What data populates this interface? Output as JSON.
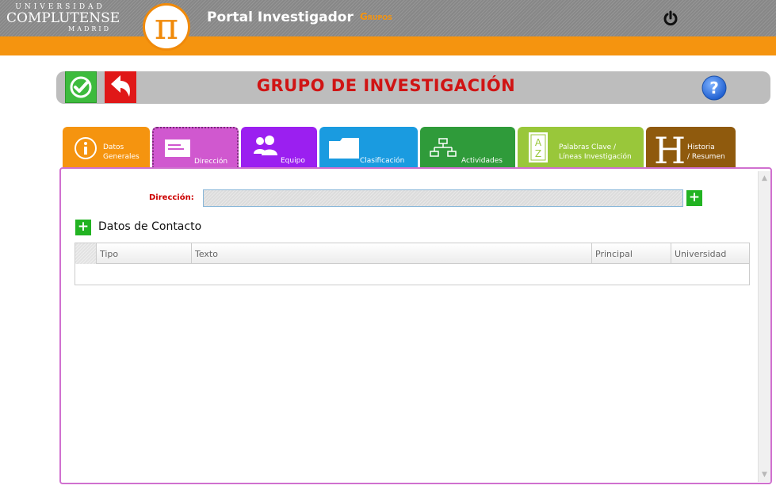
{
  "header": {
    "university_top": "UNIVERSIDAD",
    "university_mid": "COMPLUTENSE",
    "university_bot": "MADRID",
    "app_logo_symbol": "π",
    "portal_title": "Portal Investigador",
    "section_link": "Grupos",
    "power_icon": "power-icon"
  },
  "toolbar": {
    "save_icon": "check-icon",
    "back_icon": "undo-arrow-icon",
    "help_icon": "help-icon"
  },
  "page": {
    "title": "GRUPO DE INVESTIGACIÓN"
  },
  "tabs": [
    {
      "line1": "Datos",
      "line2": "Generales",
      "icon": "info-icon",
      "color": "#f5940f"
    },
    {
      "label": "Dirección",
      "icon": "address-card-icon",
      "color": "#d058cf",
      "active": true
    },
    {
      "label": "Equipo",
      "icon": "users-icon",
      "color": "#9b1ff0"
    },
    {
      "label": "Clasificación",
      "icon": "folder-icon",
      "color": "#1a9be0"
    },
    {
      "label": "Actividades",
      "icon": "hierarchy-icon",
      "color": "#2f9b3a"
    },
    {
      "line1": "Palabras Clave /",
      "line2": "Líneas Investigación",
      "icon": "az-book-icon",
      "color": "#99c73a"
    },
    {
      "line1": "Historia",
      "line2": "/ Resumen",
      "icon": "letter-h-icon",
      "color": "#8f5a0d"
    }
  ],
  "form": {
    "direccion_label": "Dirección:",
    "direccion_value": "",
    "add_symbol": "+",
    "contact_title": "Datos de Contacto"
  },
  "contact_table": {
    "columns": [
      "Tipo",
      "Texto",
      "Principal",
      "Universidad"
    ],
    "rows": []
  },
  "colors": {
    "header_orange": "#f5940f",
    "title_red": "#d01414",
    "panel_border": "#d070cf"
  }
}
